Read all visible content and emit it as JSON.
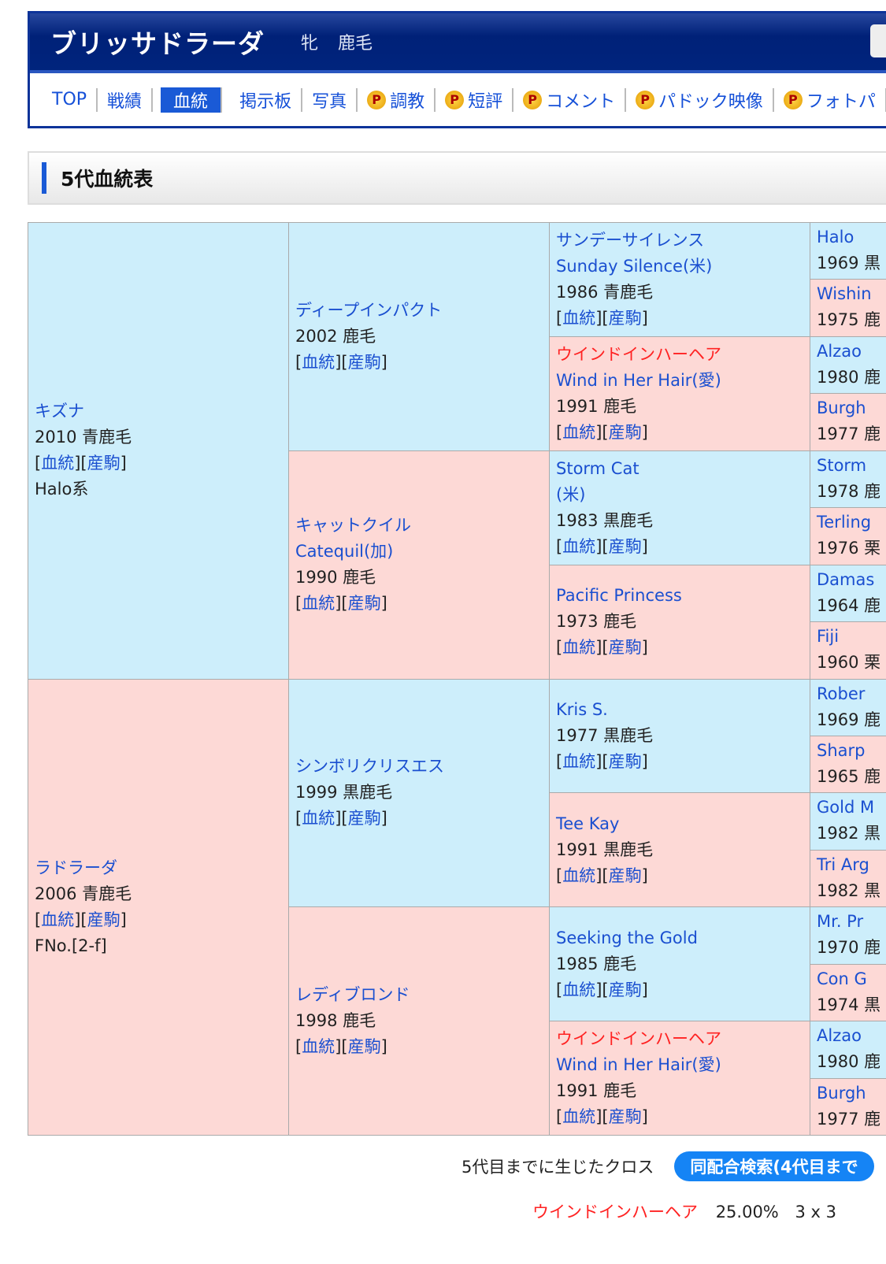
{
  "header": {
    "horse_name": "ブリッサドラーダ",
    "sex_color": "牝 鹿毛"
  },
  "nav": [
    {
      "label": "TOP"
    },
    {
      "label": "戦績"
    },
    {
      "label": "血統",
      "active": true
    },
    {
      "label": "掲示板"
    },
    {
      "label": "写真"
    },
    {
      "label": "調教",
      "premium": true
    },
    {
      "label": "短評",
      "premium": true
    },
    {
      "label": "コメント",
      "premium": true
    },
    {
      "label": "パドック映像",
      "premium": true
    },
    {
      "label": "フォトパ",
      "premium": true
    }
  ],
  "premium_icon": "P",
  "section_title": "5代血統表",
  "link_pedigree": "血統",
  "link_offspring": "産駒",
  "colors": {
    "sire_bg": "#cdeefb",
    "dam_bg": "#fdd9d6",
    "link": "#1a4fd0",
    "cross": "#ff2222"
  },
  "pedigree": {
    "gen1": [
      {
        "name": "キズナ",
        "info": "2010 青鹿毛",
        "extra": "Halo系",
        "sex": "m"
      },
      {
        "name": "ラドラーダ",
        "info": "2006 青鹿毛",
        "extra": "FNo.[2-f]",
        "sex": "f"
      }
    ],
    "gen2": [
      {
        "name": "ディープインパクト",
        "info": "2002 鹿毛",
        "sex": "m"
      },
      {
        "name": "キャットクイル",
        "name2": "Catequil(加)",
        "info": "1990 鹿毛",
        "sex": "f"
      },
      {
        "name": "シンボリクリスエス",
        "info": "1999 黒鹿毛",
        "sex": "m"
      },
      {
        "name": "レディブロンド",
        "info": "1998 鹿毛",
        "sex": "f"
      }
    ],
    "gen3": [
      {
        "name": "サンデーサイレンス",
        "name2": "Sunday Silence(米)",
        "info": "1986 青鹿毛",
        "sex": "m"
      },
      {
        "name": "ウインドインハーヘア",
        "name2": "Wind in Her Hair(愛)",
        "info": "1991 鹿毛",
        "sex": "f",
        "cross": true
      },
      {
        "name": "Storm Cat",
        "name2": "(米)",
        "info": "1983 黒鹿毛",
        "sex": "m"
      },
      {
        "name": "Pacific Princess",
        "info": "1973 鹿毛",
        "sex": "f"
      },
      {
        "name": "Kris S.",
        "info": "1977 黒鹿毛",
        "sex": "m"
      },
      {
        "name": "Tee Kay",
        "info": "1991 黒鹿毛",
        "sex": "f"
      },
      {
        "name": "Seeking the Gold",
        "info": "1985 鹿毛",
        "sex": "m"
      },
      {
        "name": "ウインドインハーヘア",
        "name2": "Wind in Her Hair(愛)",
        "info": "1991 鹿毛",
        "sex": "f",
        "cross": true
      }
    ],
    "gen4": [
      {
        "name": "Halo",
        "info": "1969 黒"
      },
      {
        "name": "Wishin",
        "info": "1975 鹿"
      },
      {
        "name": "Alzao",
        "info": "1980 鹿"
      },
      {
        "name": "Burgh",
        "info": "1977 鹿"
      },
      {
        "name": "Storm",
        "info": "1978 鹿"
      },
      {
        "name": "Terling",
        "info": "1976 栗"
      },
      {
        "name": "Damas",
        "info": "1964 鹿"
      },
      {
        "name": "Fiji",
        "info": "1960 栗"
      },
      {
        "name": "Rober",
        "info": "1969 鹿"
      },
      {
        "name": "Sharp",
        "info": "1965 鹿"
      },
      {
        "name": "Gold M",
        "info": "1982 黒"
      },
      {
        "name": "Tri Arg",
        "info": "1982 黒"
      },
      {
        "name": "Mr. Pr",
        "info": "1970 鹿"
      },
      {
        "name": "Con G",
        "info": "1974 黒"
      },
      {
        "name": "Alzao",
        "info": "1980 鹿"
      },
      {
        "name": "Burgh",
        "info": "1977 鹿"
      }
    ]
  },
  "cross": {
    "label": "5代目までに生じたクロス",
    "search_button": "同配合検索(4代目まで",
    "items": [
      {
        "name": "ウインドインハーヘア",
        "percent": "25.00%",
        "pattern": "3 x 3"
      }
    ]
  }
}
